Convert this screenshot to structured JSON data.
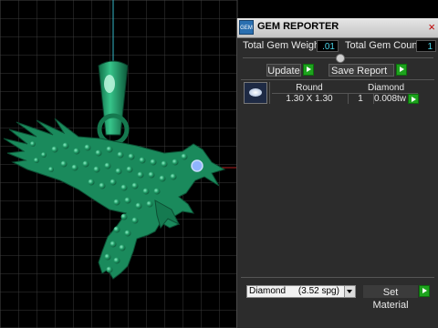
{
  "window": {
    "title": "GEM REPORTER",
    "close_glyph": "×",
    "app_icon_text": "GEM"
  },
  "stats": {
    "total_weight_label": "Total Gem Weight",
    "total_weight_value": ".01",
    "total_count_label": "Total Gem Count",
    "total_count_value": "1"
  },
  "actions": {
    "update_label": "Update",
    "save_report_label": "Save Report"
  },
  "table": {
    "headers": {
      "shape": "Round",
      "material": "Diamond"
    },
    "rows": [
      {
        "size": "1.30 X 1.30",
        "count": "1",
        "weight": "0.008tw"
      }
    ]
  },
  "footer": {
    "material_select": "Diamond     (3.52 spg)",
    "set_material_label": "Set Material"
  },
  "colors": {
    "model": "#1a8a5c",
    "value_text": "#4bd3e6",
    "accent_play": "#1da31d"
  }
}
